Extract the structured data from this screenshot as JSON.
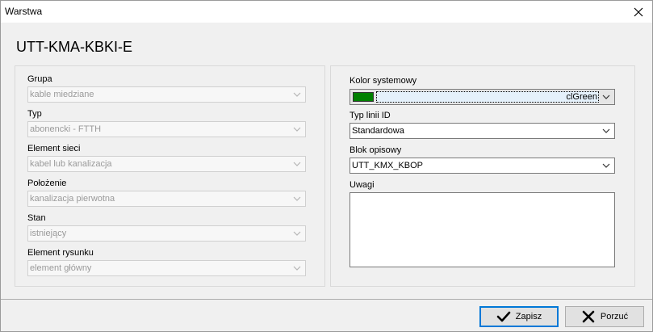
{
  "window": {
    "title": "Warstwa"
  },
  "header": {
    "title": "UTT-KMA-KBKI-E"
  },
  "left_panel": {
    "fields": [
      {
        "label": "Grupa",
        "value": "kable miedziane"
      },
      {
        "label": "Typ",
        "value": "abonencki - FTTH"
      },
      {
        "label": "Element sieci",
        "value": "kabel lub kanalizacja"
      },
      {
        "label": "Położenie",
        "value": "kanalizacja pierwotna"
      },
      {
        "label": "Stan",
        "value": "istniejący"
      },
      {
        "label": "Element rysunku",
        "value": "element główny"
      }
    ]
  },
  "right_panel": {
    "color": {
      "label": "Kolor systemowy",
      "value": "clGreen",
      "swatch": "#008000"
    },
    "line_type": {
      "label": "Typ linii ID",
      "value": "Standardowa"
    },
    "block": {
      "label": "Blok opisowy",
      "value": "UTT_KMX_KBOP"
    },
    "notes": {
      "label": "Uwagi",
      "value": ""
    }
  },
  "buttons": {
    "save": {
      "label": "Zapisz",
      "icon": "checkmark-icon"
    },
    "cancel": {
      "label": "Porzuć",
      "icon": "x-icon"
    }
  }
}
